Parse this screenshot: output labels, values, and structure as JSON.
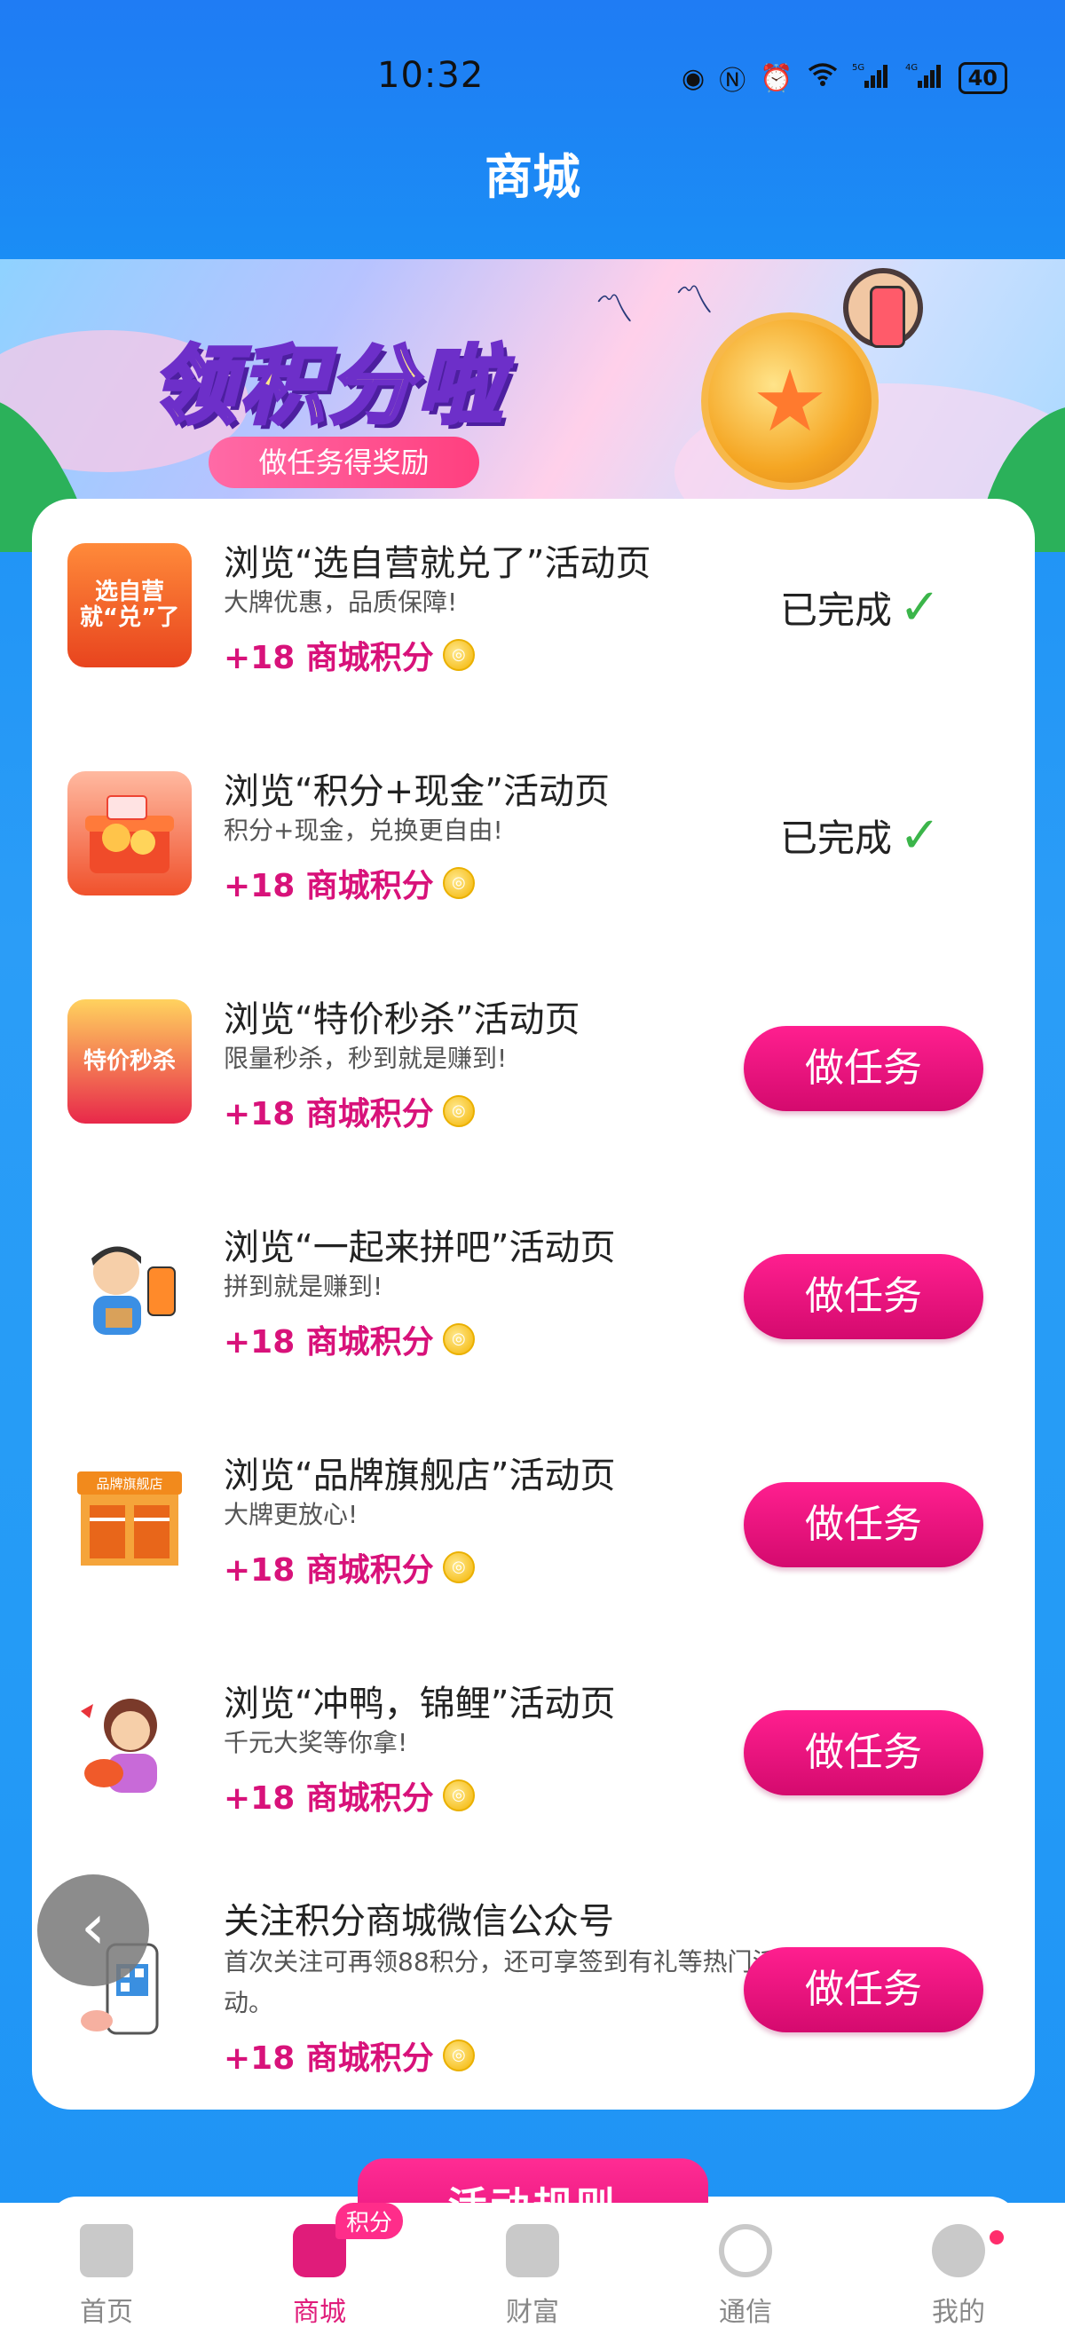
{
  "status_bar": {
    "time": "10:32",
    "icons": [
      "eye-icon",
      "nfc-icon",
      "alarm-icon",
      "wifi-icon",
      "5g-signal-icon",
      "4g-signal-icon"
    ],
    "battery": "40"
  },
  "header": {
    "title": "商城"
  },
  "banner": {
    "title": "领积分啦",
    "subtitle": "做任务得奖励"
  },
  "tasks": [
    {
      "title": "浏览“选自营就兑了”活动页",
      "desc": "大牌优惠，品质保障!",
      "points": "+18 商城积分",
      "status": "done",
      "status_label": "已完成",
      "icon": "选自营就“兑”了"
    },
    {
      "title": "浏览“积分+现金”活动页",
      "desc": "积分+现金，兑换更自由!",
      "points": "+18 商城积分",
      "status": "done",
      "status_label": "已完成",
      "icon": "gift-box-icon"
    },
    {
      "title": "浏览“特价秒杀”活动页",
      "desc": "限量秒杀，秒到就是赚到!",
      "points": "+18 商城积分",
      "status": "todo",
      "button_label": "做任务",
      "icon": "特价秒杀"
    },
    {
      "title": "浏览“一起来拼吧”活动页",
      "desc": "拼到就是赚到!",
      "points": "+18 商城积分",
      "status": "todo",
      "button_label": "做任务",
      "icon": "person-phone-icon"
    },
    {
      "title": "浏览“品牌旗舰店”活动页",
      "desc": "大牌更放心!",
      "points": "+18 商城积分",
      "status": "todo",
      "button_label": "做任务",
      "icon": "品牌旗舰店"
    },
    {
      "title": "浏览“冲鸭，锦鲤”活动页",
      "desc": "千元大奖等你拿!",
      "points": "+18 商城积分",
      "status": "todo",
      "button_label": "做任务",
      "icon": "girl-koi-icon"
    },
    {
      "title": "关注积分商城微信公众号",
      "desc": "首次关注可再领88积分，还可享签到有礼等热门活动。",
      "points": "+18 商城积分",
      "status": "todo",
      "button_label": "做任务",
      "icon": "qr-phone-icon"
    }
  ],
  "rules_button": "活动规则",
  "bottom_nav": [
    {
      "label": "首页",
      "icon": "home-icon",
      "active": false
    },
    {
      "label": "商城",
      "icon": "shopping-bag-icon",
      "active": true,
      "badge": "积分"
    },
    {
      "label": "财富",
      "icon": "wallet-icon",
      "active": false
    },
    {
      "label": "通信",
      "icon": "china-mobile-icon",
      "active": false
    },
    {
      "label": "我的",
      "icon": "profile-icon",
      "active": false,
      "dot": true
    }
  ],
  "colors": {
    "accent": "#e01c7a",
    "background": "#1f8ff5",
    "done_check": "#3bb54a"
  }
}
